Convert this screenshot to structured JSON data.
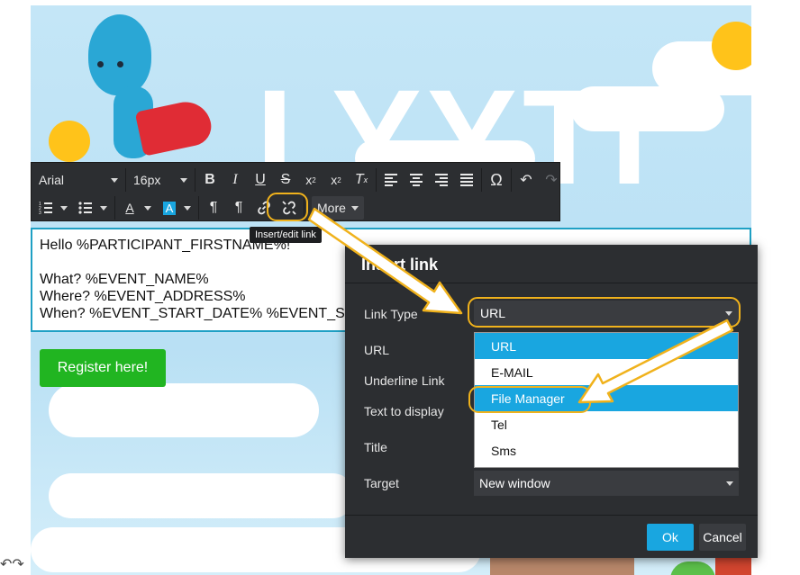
{
  "toolbar": {
    "font_family": "Arial",
    "font_size": "16px",
    "more_label": "More"
  },
  "tooltip": {
    "text": "Insert/edit link"
  },
  "editor": {
    "lines": [
      "Hello %PARTICIPANT_FIRSTNAME%!",
      "",
      "What? %EVENT_NAME%",
      "Where? %EVENT_ADDRESS%",
      "When? %EVENT_START_DATE% %EVENT_S"
    ]
  },
  "register_button": {
    "label": "Register here!"
  },
  "banner": {
    "logo_text": "LYYTI"
  },
  "dialog": {
    "title": "Insert link",
    "labels": {
      "link_type": "Link Type",
      "url": "URL",
      "underline": "Underline Link",
      "text_to_display": "Text to display",
      "title": "Title",
      "target": "Target"
    },
    "link_type_value": "URL",
    "link_type_options": [
      "URL",
      "E-MAIL",
      "File Manager",
      "Tel",
      "Sms"
    ],
    "target_value": "New window",
    "ok_label": "Ok",
    "cancel_label": "Cancel"
  },
  "colors": {
    "accent": "#19a6e0",
    "highlight": "#f0b21c",
    "register_green": "#21b521",
    "toolbar_bg": "#2c2e31"
  }
}
